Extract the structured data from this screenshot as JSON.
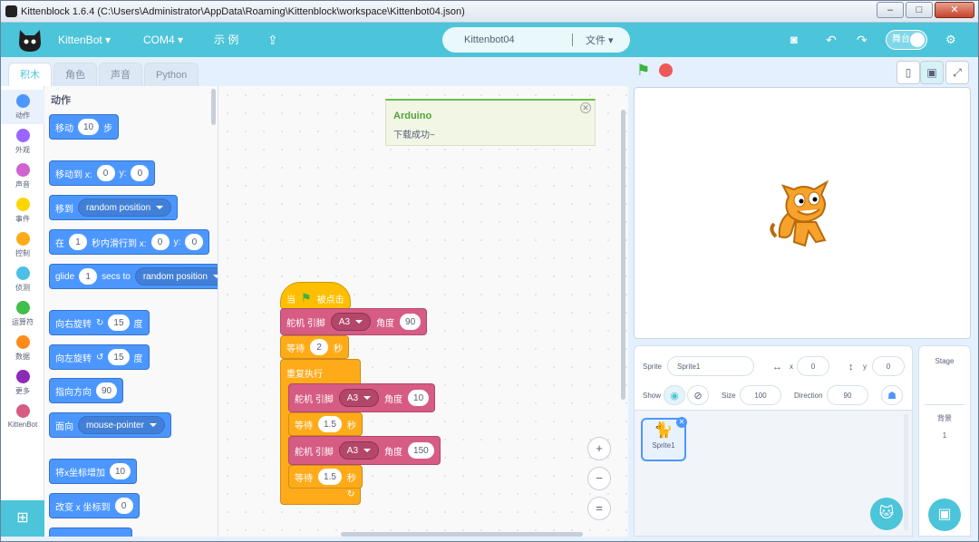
{
  "window": {
    "title": "Kittenblock 1.6.4 (C:\\Users\\Administrator\\AppData\\Roaming\\Kittenblock\\workspace\\Kittenbot04.json)"
  },
  "menubar": {
    "board": "KittenBot",
    "port": "COM4",
    "examples": "示 例",
    "project_name": "Kittenbot04",
    "file": "文件",
    "stage_toggle": "舞台"
  },
  "tabs": [
    {
      "label": "积木"
    },
    {
      "label": "角色"
    },
    {
      "label": "声音"
    },
    {
      "label": "Python"
    }
  ],
  "categories": [
    {
      "label": "动作",
      "color": "#4c97ff"
    },
    {
      "label": "外观",
      "color": "#9966ff"
    },
    {
      "label": "声音",
      "color": "#cf63cf"
    },
    {
      "label": "事件",
      "color": "#ffd500"
    },
    {
      "label": "控制",
      "color": "#ffab19"
    },
    {
      "label": "侦测",
      "color": "#4cbfe6"
    },
    {
      "label": "运算符",
      "color": "#40bf4a"
    },
    {
      "label": "数据",
      "color": "#ff8c1a"
    },
    {
      "label": "更多",
      "color": "#8c2bb5"
    },
    {
      "label": "KittenBot",
      "color": "#d65c84"
    }
  ],
  "palette": {
    "heading": "动作",
    "move": {
      "a": "移动",
      "v": "10",
      "b": "步"
    },
    "goto_xy": {
      "a": "移动到 x:",
      "x": "0",
      "b": "y:",
      "y": "0"
    },
    "goto": {
      "a": "移到",
      "opt": "random position"
    },
    "glide_xy": {
      "a": "在",
      "s": "1",
      "b": "秒内滑行到 x:",
      "x": "0",
      "c": "y:",
      "y": "0"
    },
    "glide": {
      "a": "glide",
      "s": "1",
      "b": "secs to",
      "opt": "random position"
    },
    "turn_right": {
      "a": "向右旋转",
      "v": "15",
      "b": "度"
    },
    "turn_left": {
      "a": "向左旋转",
      "v": "15",
      "b": "度"
    },
    "point_dir": {
      "a": "指向方向",
      "v": "90"
    },
    "point_towards": {
      "a": "面向",
      "opt": "mouse-pointer"
    },
    "change_x": {
      "a": "将x坐标增加",
      "v": "10"
    },
    "set_x": {
      "a": "改变 x 坐标到",
      "v": "0"
    }
  },
  "script": {
    "hat": {
      "a": "当",
      "b": "被点击"
    },
    "servo1": {
      "a": "舵机 引脚",
      "pin": "A3",
      "b": "角度",
      "v": "90"
    },
    "wait1": {
      "a": "等待",
      "v": "2",
      "b": "秒"
    },
    "forever": "重复执行",
    "servo2": {
      "a": "舵机 引脚",
      "pin": "A3",
      "b": "角度",
      "v": "10"
    },
    "wait2": {
      "a": "等待",
      "v": "1.5",
      "b": "秒"
    },
    "servo3": {
      "a": "舵机 引脚",
      "pin": "A3",
      "b": "角度",
      "v": "150"
    },
    "wait3": {
      "a": "等待",
      "v": "1.5",
      "b": "秒"
    }
  },
  "toast": {
    "title": "Arduino",
    "message": "下载成功~"
  },
  "sprite_info": {
    "sprite_label": "Sprite",
    "sprite_name": "Sprite1",
    "x_label": "x",
    "x": "0",
    "y_label": "y",
    "y": "0",
    "show_label": "Show",
    "size_label": "Size",
    "size": "100",
    "direction_label": "Direction",
    "direction": "90"
  },
  "sprites": [
    {
      "name": "Sprite1"
    }
  ],
  "stage_pane": {
    "title": "Stage",
    "backdrops_label": "背景",
    "backdrops_count": "1"
  },
  "colors": {
    "accent": "#4cc4d9",
    "motion": "#4c97ff",
    "control": "#ffab19",
    "servo": "#d65c84",
    "event": "#ffbf00"
  }
}
